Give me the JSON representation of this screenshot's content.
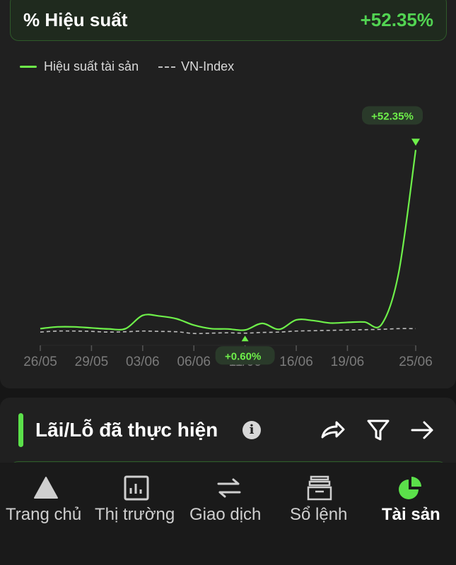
{
  "performance": {
    "title": "% Hiệu suất",
    "value": "+52.35%",
    "legend": {
      "asset": "Hiệu suất tài sản",
      "index": "VN-Index"
    }
  },
  "chart_data": {
    "type": "line",
    "x": [
      "26/05",
      "27/05",
      "28/05",
      "29/05",
      "30/05",
      "02/06",
      "03/06",
      "04/06",
      "05/06",
      "06/06",
      "09/06",
      "10/06",
      "11/06",
      "12/06",
      "13/06",
      "16/06",
      "17/06",
      "18/06",
      "19/06",
      "20/06",
      "23/06",
      "24/06",
      "25/06"
    ],
    "x_tick_labels": [
      "26/05",
      "29/05",
      "03/06",
      "06/06",
      "11/06",
      "16/06",
      "19/06",
      "25/06"
    ],
    "series": [
      {
        "name": "Hiệu suất tài sản",
        "color": "#6ef04a",
        "style": "solid",
        "values": [
          1.0,
          1.5,
          1.5,
          1.2,
          0.9,
          1.0,
          4.8,
          4.6,
          3.8,
          2.0,
          1.0,
          0.9,
          0.6,
          2.5,
          0.8,
          3.5,
          3.3,
          2.6,
          2.8,
          2.9,
          2.2,
          17.0,
          52.35
        ]
      },
      {
        "name": "VN-Index",
        "color": "#bdbdbd",
        "style": "dashed",
        "values": [
          0.0,
          0.3,
          0.3,
          0.2,
          0.0,
          0.1,
          0.3,
          0.2,
          0.1,
          -0.4,
          -0.3,
          -0.2,
          -0.3,
          -0.1,
          0.0,
          0.3,
          0.4,
          0.5,
          0.6,
          0.7,
          0.8,
          1.0,
          1.0
        ]
      }
    ],
    "annotations": [
      {
        "label": "+52.35%",
        "series": "Hiệu suất tài sản",
        "index": 22,
        "marker": "down-triangle"
      },
      {
        "label": "+0.60%",
        "series": "Hiệu suất tài sản",
        "index": 12,
        "marker": "up-triangle"
      }
    ],
    "ylim": [
      -3,
      65
    ],
    "grid": false,
    "legend": "top-left"
  },
  "pnl": {
    "title": "Lãi/Lỗ đã thực hiện",
    "info_icon": "info-icon",
    "share_icon": "share-icon",
    "filter_icon": "filter-icon",
    "arrow_icon": "arrow-right-icon"
  },
  "nav": {
    "items": [
      {
        "label": "Trang chủ",
        "icon": "home-icon",
        "active": false
      },
      {
        "label": "Thị trường",
        "icon": "market-icon",
        "active": false
      },
      {
        "label": "Giao dịch",
        "icon": "transfer-icon",
        "active": false
      },
      {
        "label": "Sổ lệnh",
        "icon": "orderbook-icon",
        "active": false
      },
      {
        "label": "Tài sản",
        "icon": "assets-pie-icon",
        "active": true
      }
    ],
    "active_color": "#5be04a"
  }
}
